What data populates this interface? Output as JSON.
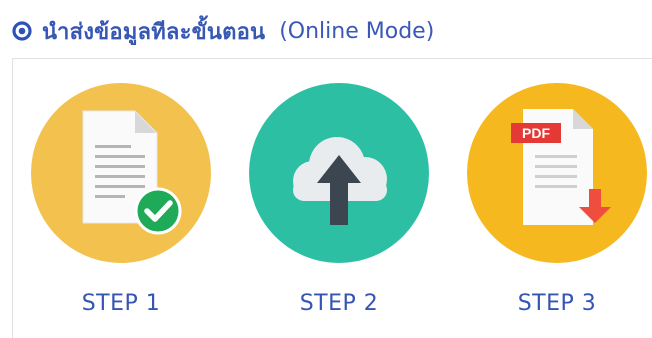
{
  "header": {
    "title": "นำส่งข้อมูลทีละขั้นตอน",
    "mode": "(Online Mode)",
    "color": "#3657b4"
  },
  "steps": [
    {
      "label": "STEP 1",
      "icon": "document-check-icon",
      "circle_color": "#f2c14e"
    },
    {
      "label": "STEP 2",
      "icon": "cloud-upload-icon",
      "circle_color": "#2cbfa4"
    },
    {
      "label": "STEP 3",
      "icon": "pdf-download-icon",
      "circle_color": "#f6b81f"
    }
  ],
  "pdf_badge": "PDF"
}
